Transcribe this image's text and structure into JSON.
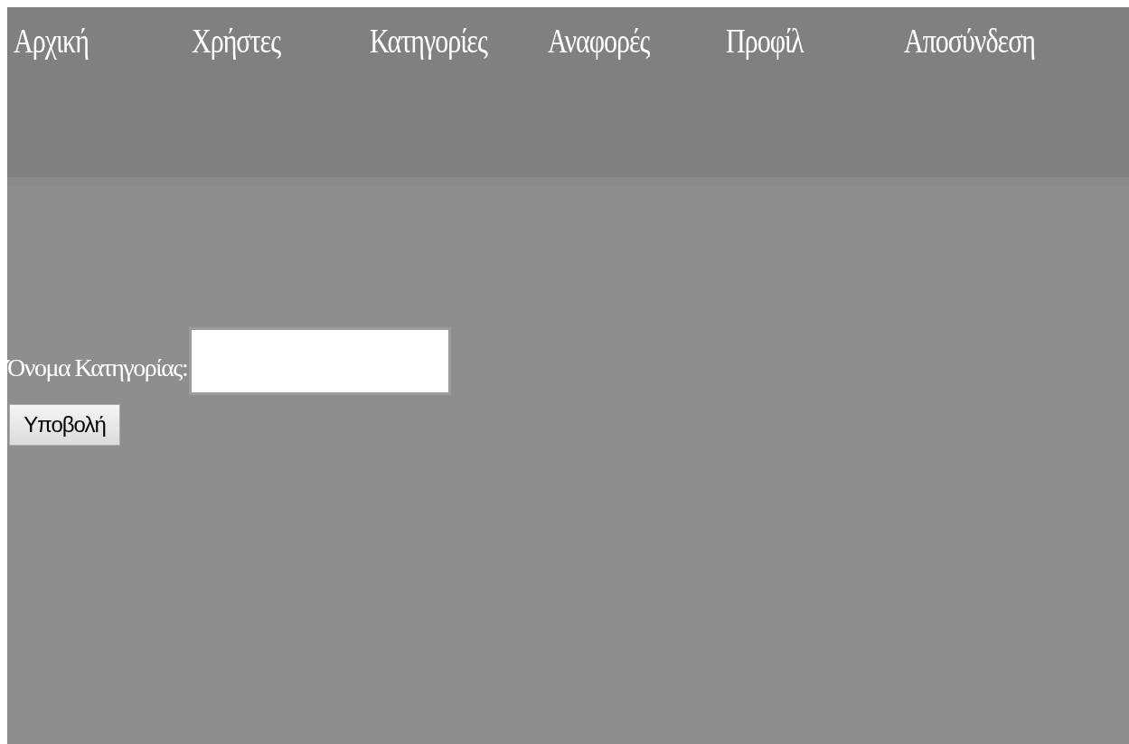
{
  "nav": {
    "items": [
      {
        "label": "Αρχική"
      },
      {
        "label": "Χρήστες"
      },
      {
        "label": "Κατηγορίες"
      },
      {
        "label": "Αναφορές"
      },
      {
        "label": "Προφίλ"
      },
      {
        "label": "Αποσύνδεση"
      }
    ]
  },
  "form": {
    "label": "Όνομα Κατηγορίας:",
    "submit": "Υποβολή"
  }
}
